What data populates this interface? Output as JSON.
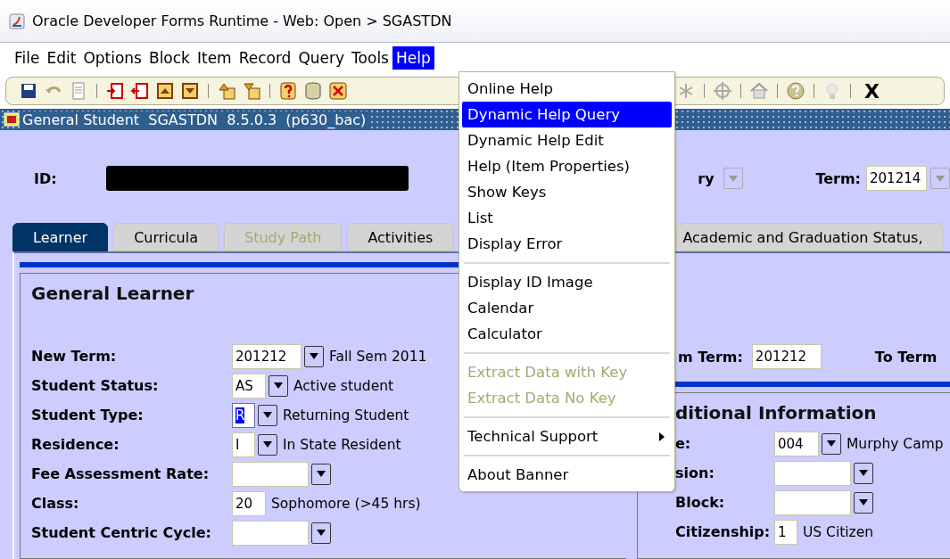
{
  "window": {
    "title": "Oracle Developer Forms Runtime - Web:  Open > SGASTDN"
  },
  "menu_bar": [
    {
      "label": "File",
      "selected": false
    },
    {
      "label": "Edit",
      "selected": false
    },
    {
      "label": "Options",
      "selected": false
    },
    {
      "label": "Block",
      "selected": false
    },
    {
      "label": "Item",
      "selected": false
    },
    {
      "label": "Record",
      "selected": false
    },
    {
      "label": "Query",
      "selected": false
    },
    {
      "label": "Tools",
      "selected": false
    },
    {
      "label": "Help",
      "selected": true
    }
  ],
  "toolbar": {
    "exit_label": "X"
  },
  "help_menu": [
    {
      "kind": "item",
      "label": "Online Help",
      "selected": false,
      "disabled": false
    },
    {
      "kind": "item",
      "label": "Dynamic Help Query",
      "selected": true,
      "disabled": false
    },
    {
      "kind": "item",
      "label": "Dynamic Help Edit",
      "selected": false,
      "disabled": false
    },
    {
      "kind": "item",
      "label": "Help (Item Properties)",
      "selected": false,
      "disabled": false
    },
    {
      "kind": "item",
      "label": "Show Keys",
      "selected": false,
      "disabled": false
    },
    {
      "kind": "item",
      "label": "List",
      "selected": false,
      "disabled": false
    },
    {
      "kind": "item",
      "label": "Display Error",
      "selected": false,
      "disabled": false
    },
    {
      "kind": "separator"
    },
    {
      "kind": "item",
      "label": "Display ID Image",
      "selected": false,
      "disabled": false
    },
    {
      "kind": "item",
      "label": "Calendar",
      "selected": false,
      "disabled": false
    },
    {
      "kind": "item",
      "label": "Calculator",
      "selected": false,
      "disabled": false
    },
    {
      "kind": "separator"
    },
    {
      "kind": "item",
      "label": "Extract Data with Key",
      "selected": false,
      "disabled": true
    },
    {
      "kind": "item",
      "label": "Extract Data No Key",
      "selected": false,
      "disabled": true
    },
    {
      "kind": "separator"
    },
    {
      "kind": "submenu",
      "label": "Technical Support",
      "selected": false,
      "disabled": false
    },
    {
      "kind": "separator"
    },
    {
      "kind": "item",
      "label": "About Banner",
      "selected": false,
      "disabled": false
    }
  ],
  "form_title": "General Student  SGASTDN  8.5.0.3  (p630_bac)",
  "key_block": {
    "id_label": "ID:",
    "partial_label": "ry",
    "term_label": "Term:",
    "term_value": "201214"
  },
  "tabs": [
    {
      "label": "Learner",
      "selected": true,
      "disabled": false
    },
    {
      "label": "Curricula",
      "selected": false,
      "disabled": false
    },
    {
      "label": "Study Path",
      "selected": false,
      "disabled": true
    },
    {
      "label": "Activities",
      "selected": false,
      "disabled": false
    },
    {
      "label": "Academic and Graduation Status,",
      "selected": false,
      "disabled": false
    }
  ],
  "learner": {
    "title": "General Learner",
    "fields": [
      {
        "label": "New Term:",
        "value": "201212",
        "kind": "lookup",
        "description": "Fall Sem 2011",
        "highlighted": false
      },
      {
        "label": "Student Status:",
        "value": "AS",
        "kind": "lookup",
        "description": "Active student",
        "highlighted": false
      },
      {
        "label": "Student Type:",
        "value": "R",
        "kind": "lookup",
        "description": "Returning Student",
        "highlighted": true
      },
      {
        "label": "Residence:",
        "value": "I",
        "kind": "lookup",
        "description": "In State Resident",
        "highlighted": false
      },
      {
        "label": "Fee Assessment Rate:",
        "kind": "lookup",
        "highlighted": false
      },
      {
        "label": "Class:",
        "value": "20",
        "kind": "text",
        "description": "Sophomore (>45 hrs)",
        "highlighted": false
      },
      {
        "label": "Student Centric Cycle:",
        "kind": "lookup",
        "highlighted": false
      }
    ]
  },
  "dates": {
    "from_label": "m Term:",
    "from_value": "201212",
    "to_label": "To Term"
  },
  "additional": {
    "title": "ditional Information",
    "fields": [
      {
        "label": "e:",
        "value": "004",
        "kind": "lookup",
        "description": "Murphy Camp",
        "highlighted": false
      },
      {
        "label": "sion:",
        "kind": "lookup",
        "highlighted": false
      },
      {
        "label": "Block:",
        "kind": "lookup",
        "highlighted": false
      },
      {
        "label": "Citizenship:",
        "value": "1",
        "kind": "text",
        "description": "US Citizen",
        "highlighted": false
      }
    ]
  }
}
